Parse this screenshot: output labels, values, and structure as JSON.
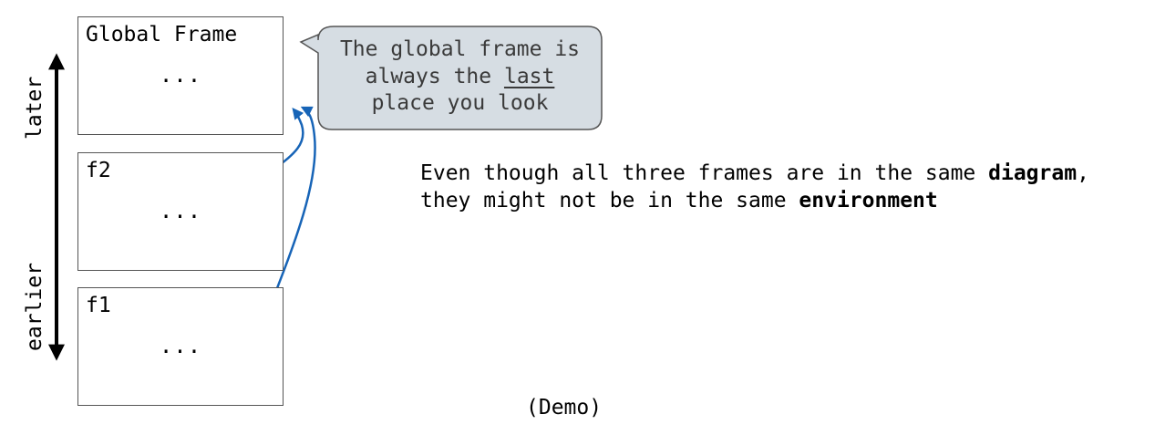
{
  "frames": {
    "global": {
      "title": "Global Frame",
      "body": "..."
    },
    "f2": {
      "title": "f2",
      "body": "..."
    },
    "f1": {
      "title": "f1",
      "body": "..."
    }
  },
  "axis": {
    "top_label": "later",
    "bottom_label": "earlier"
  },
  "callout": {
    "line1": "The global frame is",
    "line2_before": "always the ",
    "line2_underlined": "last",
    "line3": "place you look"
  },
  "note": {
    "line1_before": "Even though all three frames are in the same ",
    "line1_bold": "diagram",
    "line1_after": ",",
    "line2_before": "they might not be in the same ",
    "line2_bold": "environment"
  },
  "demo_label": "(Demo)",
  "colors": {
    "arrow": "#1764b7",
    "callout_fill": "#d6dde3",
    "callout_border": "#555555",
    "frame_border": "#555555"
  }
}
